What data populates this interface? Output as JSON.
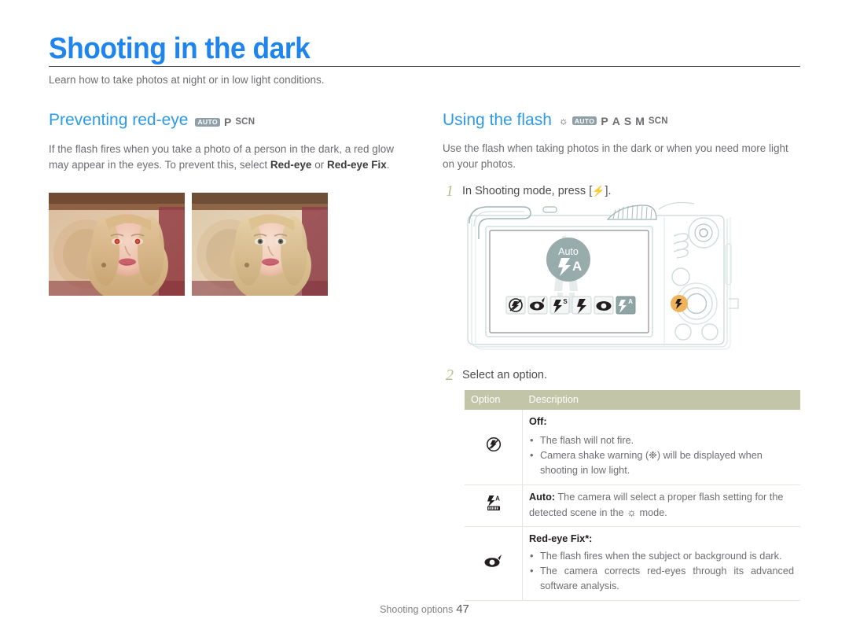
{
  "page": {
    "title": "Shooting in the dark",
    "subtitle": "Learn how to take photos at night or in low light conditions.",
    "accent_color": "#1f85ed",
    "heading_color": "#2d9ae8",
    "table_header_color": "#c3c5a8",
    "step_number_color": "#b9bd8e",
    "highlight_button_color": "#f0b35b"
  },
  "footer": {
    "label": "Shooting options",
    "page_number": "47"
  },
  "left_column": {
    "heading": "Preventing red-eye",
    "modes": [
      "AUTO",
      "P",
      "SCN"
    ],
    "paragraph_parts": [
      {
        "text": "If the flash fires when you take a photo of a person in the dark, a red glow may appear in the eyes. To prevent this, select ",
        "bold": false
      },
      {
        "text": "Red-eye",
        "bold": true
      },
      {
        "text": " or ",
        "bold": false
      },
      {
        "text": "Red-eye Fix",
        "bold": true
      },
      {
        "text": ".",
        "bold": false
      }
    ],
    "images": [
      {
        "name": "photo-with-red-eye",
        "caption": ""
      },
      {
        "name": "photo-red-eye-corrected",
        "caption": ""
      }
    ]
  },
  "right_column": {
    "heading": "Using the flash",
    "modes": [
      "SMART_AUTO",
      "AUTO",
      "P",
      "A",
      "S",
      "M",
      "SCN"
    ],
    "paragraph": "Use the flash when taking photos in the dark or when you need more light on your photos.",
    "steps": [
      {
        "number": "1",
        "text_before": "In Shooting mode, press [",
        "icon": "flash-icon",
        "text_after": "]."
      },
      {
        "number": "2",
        "text_before": "Select an option.",
        "icon": "",
        "text_after": ""
      }
    ],
    "camera_screen": {
      "mode_bubble_label": "Auto",
      "mode_bubble_icon": "flash-auto-icon",
      "option_icons": [
        "flash-off-icon",
        "red-eye-fix-icon",
        "slow-sync-icon",
        "fill-in-flash-icon",
        "red-eye-icon",
        "flash-auto-icon"
      ],
      "selected_option_index": 5,
      "highlighted_button": "flash-button"
    },
    "table": {
      "headers": [
        "Option",
        "Description"
      ],
      "rows": [
        {
          "icon": "flash-off-icon",
          "title": "Off",
          "title_suffix": ":",
          "bullets": [
            "The flash will not fire.",
            "Camera shake warning (❉) will be displayed when shooting in low light."
          ],
          "paragraph": ""
        },
        {
          "icon": "flash-auto-detect-icon",
          "title": "Auto",
          "title_suffix": ":",
          "bullets": [],
          "paragraph": " The camera will select a proper flash setting for the detected scene in the ■ mode.",
          "paragraph_pre": " The camera will select a proper flash setting for the detected scene in the ",
          "paragraph_post": " mode.",
          "inline_icon": "smart-auto-icon"
        },
        {
          "icon": "red-eye-fix-icon",
          "title": "Red-eye Fix",
          "title_suffix": "*:",
          "bullets": [
            "The flash fires when the subject or background is dark.",
            "The camera corrects red-eyes through its advanced software analysis."
          ],
          "paragraph": ""
        }
      ]
    }
  }
}
